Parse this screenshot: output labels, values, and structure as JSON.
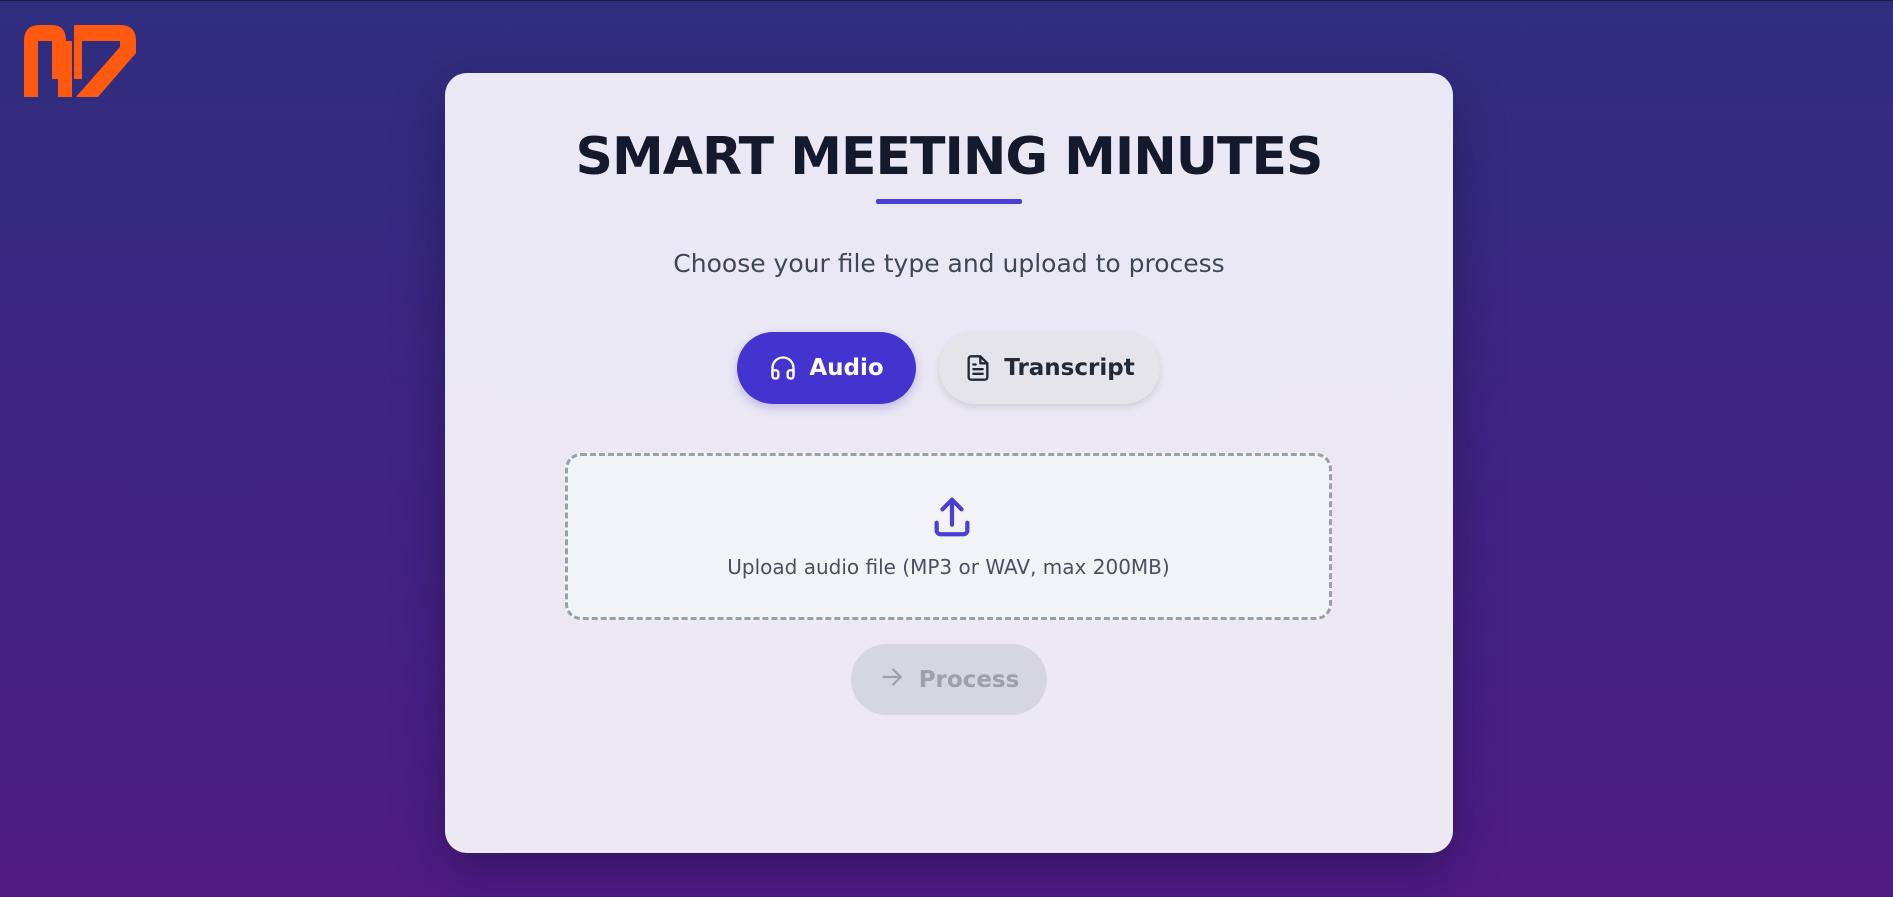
{
  "brand": {
    "logo_icon": "md-logo-icon",
    "logo_color": "#ff5a0f"
  },
  "page": {
    "title": "SMART MEETING MINUTES",
    "subtitle": "Choose your file type and upload to process"
  },
  "file_types": {
    "selected": "audio",
    "audio": {
      "label": "Audio",
      "icon": "headphones-icon"
    },
    "transcript": {
      "label": "Transcript",
      "icon": "document-icon"
    }
  },
  "upload": {
    "icon": "upload-icon",
    "hint": "Upload audio file (MP3 or WAV, max 200MB)"
  },
  "actions": {
    "process_label": "Process",
    "process_icon": "arrow-right-icon",
    "process_enabled": false
  },
  "colors": {
    "accent": "#4334cf",
    "title_text": "#141a2b",
    "disabled_bg": "#d6d7de",
    "disabled_text": "#9ca1ab"
  }
}
